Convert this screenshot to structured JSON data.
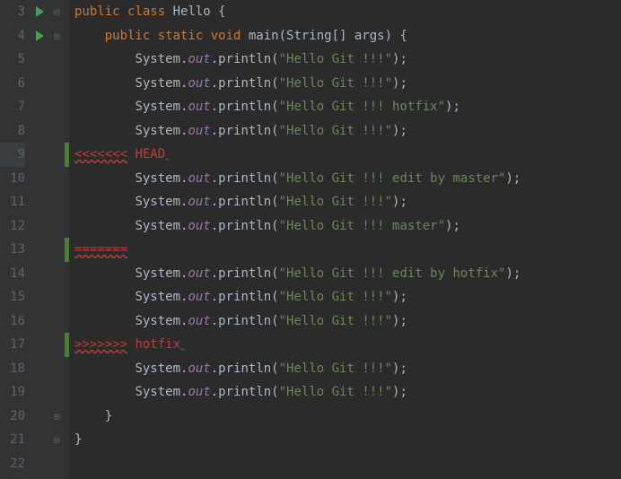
{
  "lines": [
    {
      "num": "3",
      "run": true
    },
    {
      "num": "4",
      "run": true
    },
    {
      "num": "5"
    },
    {
      "num": "6"
    },
    {
      "num": "7"
    },
    {
      "num": "8"
    },
    {
      "num": "9",
      "hl": true
    },
    {
      "num": "10"
    },
    {
      "num": "11"
    },
    {
      "num": "12"
    },
    {
      "num": "13"
    },
    {
      "num": "14"
    },
    {
      "num": "15"
    },
    {
      "num": "16"
    },
    {
      "num": "17"
    },
    {
      "num": "18"
    },
    {
      "num": "19"
    },
    {
      "num": "20"
    },
    {
      "num": "21"
    },
    {
      "num": "22"
    }
  ],
  "code": {
    "l3": {
      "kw1": "public class",
      "cls": " Hello {",
      "indent": ""
    },
    "l4": {
      "indent": "    ",
      "kw": "public static void",
      "rest": " main(String[] args) {"
    },
    "println_prefix_indent": "        ",
    "sys": "System.",
    "out": "out",
    "println_open": ".println(",
    "println_close": ");",
    "s5": "\"Hello Git !!!\"",
    "s6": "\"Hello Git !!!\"",
    "s7": "\"Hello Git !!! hotfix\"",
    "s8": "\"Hello Git !!!\"",
    "s10": "\"Hello Git !!! edit by master\"",
    "s11": "\"Hello Git !!!\"",
    "s12": "\"Hello Git !!! master\"",
    "s14": "\"Hello Git !!! edit by hotfix\"",
    "s15": "\"Hello Git !!!\"",
    "s16": "\"Hello Git !!!\"",
    "s18": "\"Hello Git !!!\"",
    "s19": "\"Hello Git !!!\"",
    "conflict_start": "<<<<<<<",
    "conflict_head": " HEAD",
    "conflict_sep": "=======",
    "conflict_end": ">>>>>>>",
    "conflict_branch": " hotfix",
    "close_inner_indent": "    ",
    "close_brace": "}",
    "close_outer_indent": ""
  }
}
